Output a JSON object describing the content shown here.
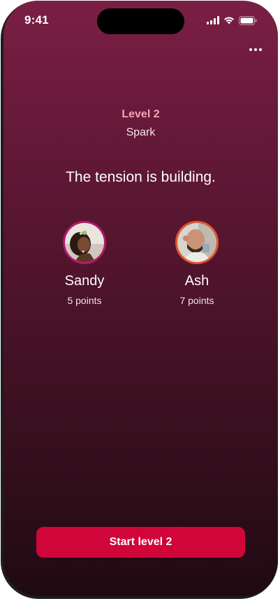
{
  "status_bar": {
    "time": "9:41",
    "icons": [
      "cellular-signal-icon",
      "wifi-icon",
      "battery-icon"
    ]
  },
  "header": {
    "menu_icon": "more-horizontal-icon"
  },
  "level": {
    "label": "Level 2",
    "name": "Spark"
  },
  "headline": "The tension is building.",
  "players": [
    {
      "name": "Sandy",
      "points": "5 points",
      "ring_color": "#b3176a"
    },
    {
      "name": "Ash",
      "points": "7 points",
      "ring_color": "#e2542e"
    }
  ],
  "actions": {
    "start_label": "Start level 2"
  },
  "colors": {
    "background_top": "#7a1f44",
    "background_bottom": "#1f0a12",
    "level_accent": "#f5a3b5",
    "button": "#d0053a"
  }
}
